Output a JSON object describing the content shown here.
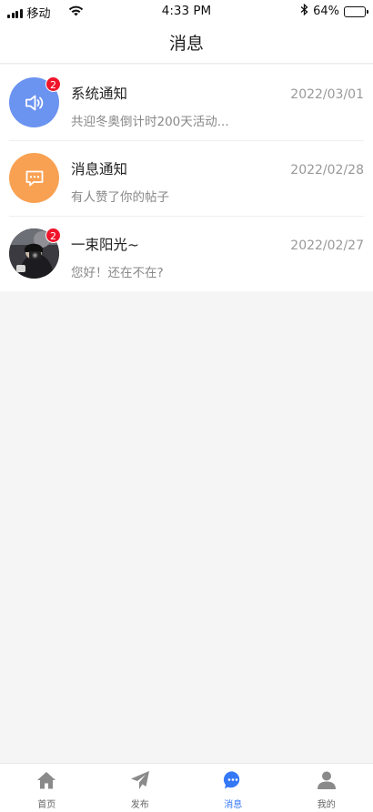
{
  "status_bar": {
    "carrier": "移动",
    "time": "4:33 PM",
    "battery_percent": "64%",
    "battery_level": 0.64,
    "icons": [
      "signal-icon",
      "wifi-icon",
      "bluetooth-icon",
      "battery-icon"
    ]
  },
  "header": {
    "title": "消息"
  },
  "messages": [
    {
      "title": "系统通知",
      "date": "2022/03/01",
      "preview": "共迎冬奥倒计时200天活动...",
      "badge": "2",
      "icon": "speaker-icon",
      "color": "#6b93f0"
    },
    {
      "title": "消息通知",
      "date": "2022/02/28",
      "preview": "有人赞了你的帖子",
      "icon": "chat-bubble-icon",
      "color": "#f9a153"
    },
    {
      "title": "一束阳光~",
      "date": "2022/02/27",
      "preview": "您好！还在不在?",
      "badge": "2",
      "icon": "user-avatar-photo"
    }
  ],
  "tabbar": {
    "tabs": [
      {
        "label": "首页",
        "icon": "home-icon",
        "active": false
      },
      {
        "label": "发布",
        "icon": "paper-plane-icon",
        "active": false
      },
      {
        "label": "消息",
        "icon": "chat-bubble-icon",
        "active": true
      },
      {
        "label": "我的",
        "icon": "person-icon",
        "active": false
      }
    ],
    "active_color": "#3478f6",
    "inactive_color": "#8a8a8a"
  }
}
